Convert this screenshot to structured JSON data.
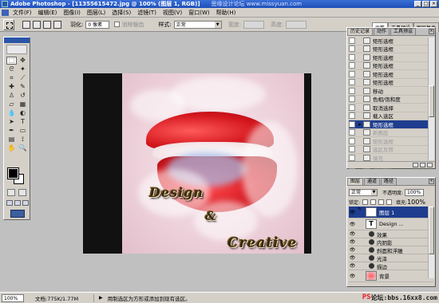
{
  "titlebar": {
    "title": "Adobe Photoshop - [11355615472.jpg @ 100% (图层 1, RGB)]",
    "watermark": "思缘设计论坛 www.missyuan.com",
    "buttons": [
      "_",
      "□",
      "×"
    ]
  },
  "menubar": {
    "items": [
      "文件(F)",
      "编辑(E)",
      "图像(I)",
      "图层(L)",
      "选择(S)",
      "滤镜(T)",
      "视图(V)",
      "窗口(W)",
      "帮助(H)"
    ]
  },
  "options": {
    "feather_label": "羽化:",
    "feather_value": "0 像素",
    "antialias_label": "消除锯齿",
    "style_label": "样式:",
    "style_value": "正常",
    "width_label": "宽度:",
    "height_label": "高度:"
  },
  "palette_well": {
    "tabs": [
      "画笔",
      "工具预设",
      "图层复合"
    ]
  },
  "canvas": {
    "word1": "Design",
    "word2": "&",
    "word3": "Creative"
  },
  "history": {
    "tabs": [
      "历史记录",
      "动作",
      "工具预设"
    ],
    "close": "×",
    "items": [
      {
        "label": "矩形选框",
        "state": "normal",
        "icon": "marquee-icon"
      },
      {
        "label": "矩形选框",
        "state": "normal",
        "icon": "marquee-icon"
      },
      {
        "label": "矩形选框",
        "state": "normal",
        "icon": "marquee-icon"
      },
      {
        "label": "矩形选框",
        "state": "normal",
        "icon": "marquee-icon"
      },
      {
        "label": "矩形选框",
        "state": "normal",
        "icon": "marquee-icon"
      },
      {
        "label": "矩形选框",
        "state": "normal",
        "icon": "marquee-icon"
      },
      {
        "label": "移动",
        "state": "normal",
        "icon": "move-icon"
      },
      {
        "label": "色相/饱和度",
        "state": "normal",
        "icon": "adjust-icon"
      },
      {
        "label": "取消选择",
        "state": "normal",
        "icon": "deselect-icon"
      },
      {
        "label": "载入选区",
        "state": "normal",
        "icon": "load-selection-icon"
      },
      {
        "label": "矩形选框",
        "state": "active",
        "icon": "marquee-icon"
      },
      {
        "label": "新图层",
        "state": "undone",
        "icon": "layer-icon"
      },
      {
        "label": "矩形选框",
        "state": "undone",
        "icon": "marquee-icon"
      },
      {
        "label": "选区反转",
        "state": "undone",
        "icon": "invert-icon"
      },
      {
        "label": "填充",
        "state": "undone",
        "icon": "fill-icon"
      },
      {
        "label": "取消选择",
        "state": "undone",
        "icon": "deselect-icon"
      }
    ]
  },
  "layers": {
    "tabs": [
      "图层",
      "通道",
      "路径"
    ],
    "close": "×",
    "blend_mode": "正常",
    "opacity_label": "不透明度:",
    "opacity_value": "100%",
    "lock_label": "锁定:",
    "fill_label": "填充:",
    "fill_value": "100%",
    "rows": [
      {
        "name": "图层 1",
        "kind": "layer",
        "selected": true
      },
      {
        "name": "Design ...",
        "kind": "text",
        "selected": false
      },
      {
        "name": "效果",
        "kind": "effects",
        "selected": false
      },
      {
        "name": "内阴影",
        "kind": "fx",
        "selected": false
      },
      {
        "name": "斜面和浮雕",
        "kind": "fx",
        "selected": false
      },
      {
        "name": "光泽",
        "kind": "fx",
        "selected": false
      },
      {
        "name": "描边",
        "kind": "fx",
        "selected": false
      },
      {
        "name": "背景",
        "kind": "background",
        "selected": false
      }
    ]
  },
  "status": {
    "zoom": "100%",
    "docsize": "文档:775K/1.77M",
    "hint": "用制选区为方形或添加到现有选区。"
  },
  "site_logo": {
    "ps": "PS",
    "rest": "论坛:bbs.16xx8.com"
  },
  "colors": {
    "titlebar": "#1d4fb8",
    "selection": "#1e3d8f",
    "lip_red": "#d2151c"
  }
}
